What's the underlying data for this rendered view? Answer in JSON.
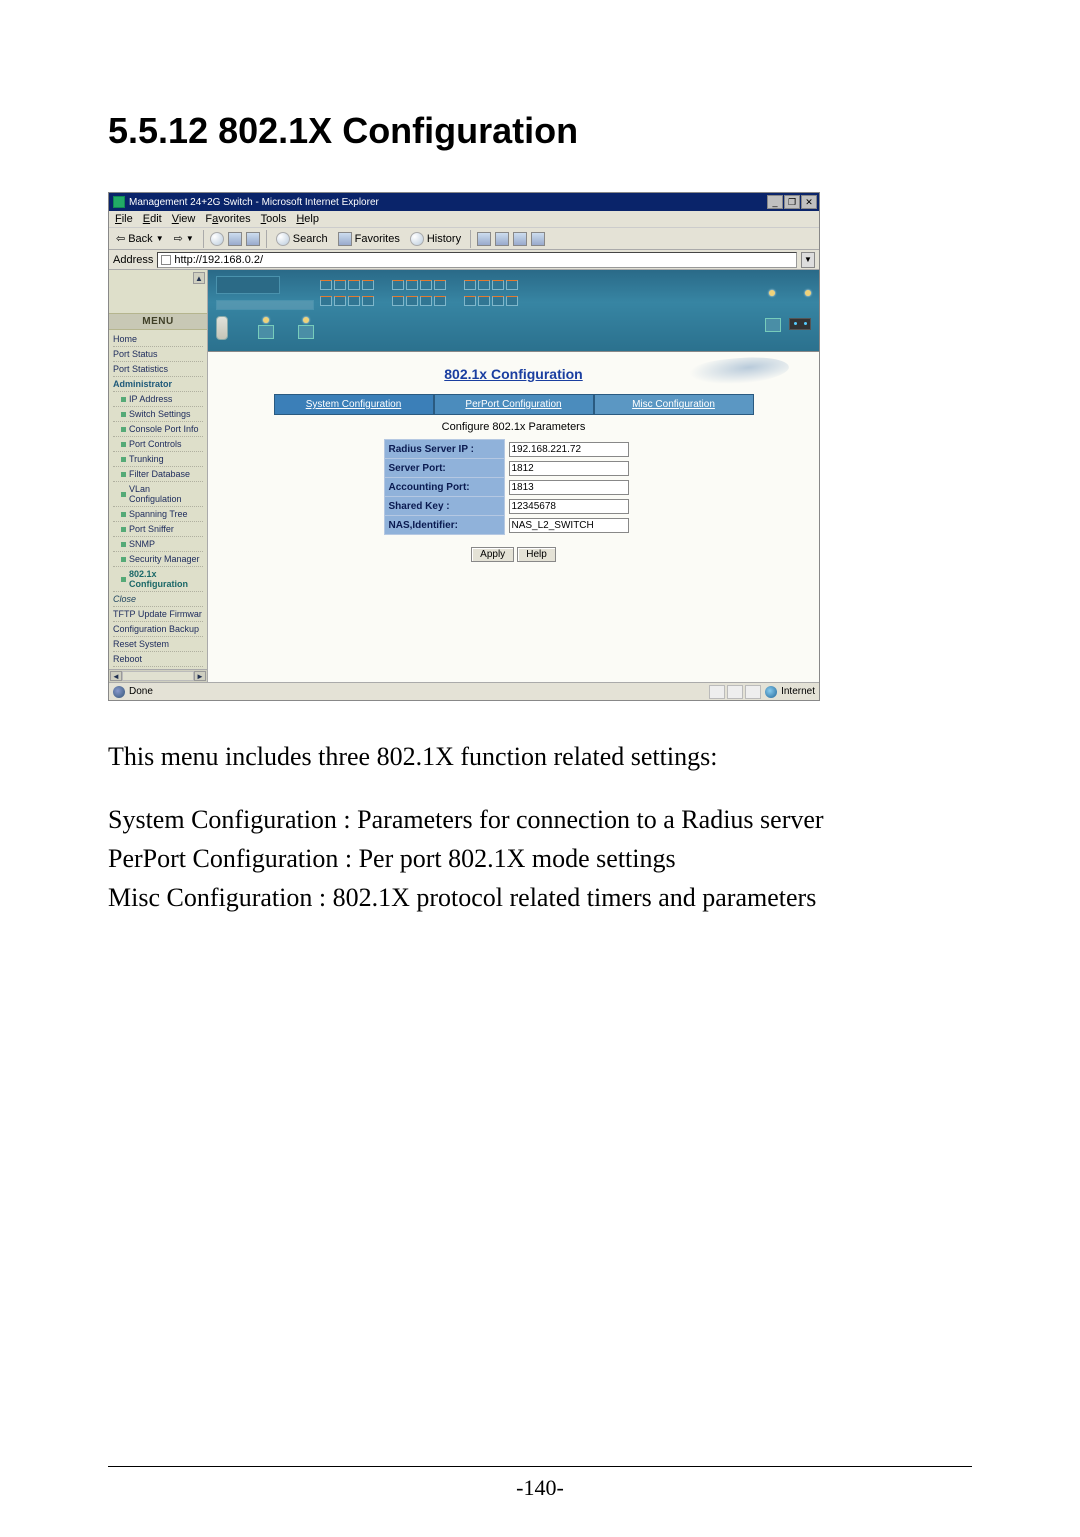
{
  "document": {
    "section_number": "5.5.12",
    "section_title": "802.1X Configuration",
    "heading": "5.5.12 802.1X Configuration",
    "paragraph": "This menu includes three 802.1X function related settings:",
    "lines": [
      "System Configuration : Parameters for connection to a Radius server",
      "PerPort Configuration : Per port 802.1X mode settings",
      "Misc Configuration : 802.1X protocol related timers and parameters"
    ],
    "page_number": "-140-"
  },
  "browser": {
    "window_title": "Management 24+2G Switch - Microsoft Internet Explorer",
    "menubar": [
      "File",
      "Edit",
      "View",
      "Favorites",
      "Tools",
      "Help"
    ],
    "toolbar": {
      "back": "Back",
      "search": "Search",
      "favorites": "Favorites",
      "history": "History"
    },
    "address_label": "Address",
    "url": "http://192.168.0.2/",
    "statusbar": {
      "left": "Done",
      "zone": "Internet"
    }
  },
  "sidebar": {
    "header": "MENU",
    "items_top": [
      "Home",
      "Port Status",
      "Port Statistics",
      "Administrator"
    ],
    "items_sub": [
      "IP Address",
      "Switch Settings",
      "Console Port Info",
      "Port Controls",
      "Trunking",
      "Filter Database",
      "VLan Configulation",
      "Spanning Tree",
      "Port Sniffer",
      "SNMP",
      "Security Manager",
      "802.1x Configuration"
    ],
    "close_label": "Close",
    "items_bottom": [
      "TFTP Update Firmwar",
      "Configuration Backup",
      "Reset System",
      "Reboot"
    ]
  },
  "content": {
    "page_title": "802.1x Configuration",
    "tabs": {
      "system": "System Configuration",
      "perport": "PerPort Configuration",
      "misc": "Misc Configuration"
    },
    "subtitle": "Configure 802.1x Parameters",
    "form": {
      "radius_ip": {
        "label": "Radius Server IP :",
        "value": "192.168.221.72"
      },
      "server_port": {
        "label": "Server Port:",
        "value": "1812"
      },
      "acct_port": {
        "label": "Accounting Port:",
        "value": "1813"
      },
      "shared_key": {
        "label": "Shared Key :",
        "value": "12345678"
      },
      "nas_id": {
        "label": "NAS,Identifier:",
        "value": "NAS_L2_SWITCH"
      }
    },
    "buttons": {
      "apply": "Apply",
      "help": "Help"
    }
  }
}
